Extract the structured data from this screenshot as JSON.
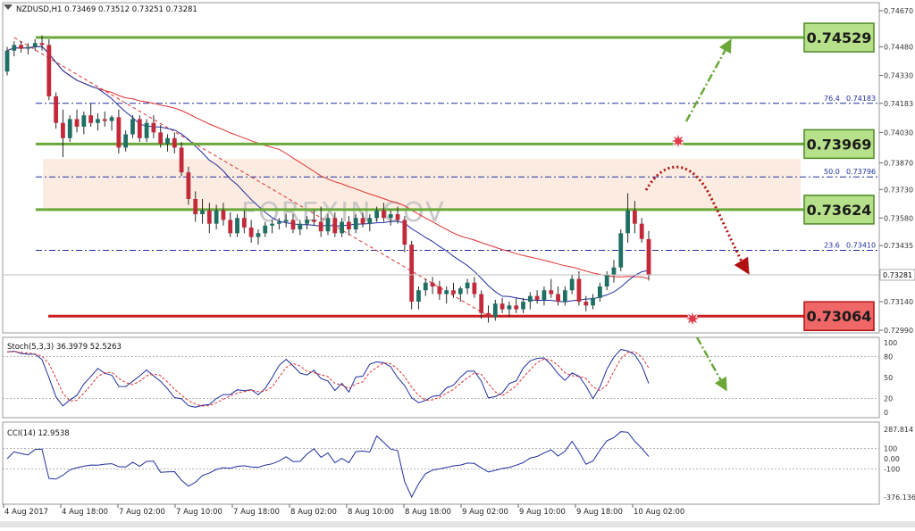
{
  "chart_data": [
    {
      "type": "candlestick",
      "symbol_header": "NZDUSD,H1  0.73469 0.73512 0.73251 0.73281",
      "watermark": "FOREXIN.COV",
      "ylim": [
        0.7299,
        0.7467
      ],
      "y_ticks": [
        "0.74670",
        "0.74480",
        "0.74330",
        "0.74183",
        "0.74030",
        "0.73870",
        "0.73730",
        "0.73580",
        "0.73435",
        "0.73140",
        "0.72990"
      ],
      "current_price": "0.73281",
      "x_ticks": [
        "4 Aug 2017",
        "4 Aug 18:00",
        "7 Aug 02:00",
        "7 Aug 10:00",
        "7 Aug 18:00",
        "8 Aug 02:00",
        "8 Aug 10:00",
        "8 Aug 18:00",
        "9 Aug 02:00",
        "9 Aug 10:00",
        "9 Aug 18:00",
        "10 Aug 02:00"
      ],
      "levels": [
        {
          "label": "0.74529",
          "value": 0.74529,
          "color": "#6aa83a"
        },
        {
          "label": "0.73969",
          "value": 0.73969,
          "color": "#6aa83a"
        },
        {
          "label": "0.73624",
          "value": 0.73624,
          "color": "#6aa83a"
        },
        {
          "label": "0.73064",
          "value": 0.73064,
          "color": "#cc1f1f"
        }
      ],
      "fibonacci": [
        {
          "label": "76.4",
          "price": "0.74183",
          "value": 0.74183
        },
        {
          "label": "50.0",
          "price": "0.73796",
          "value": 0.73796
        },
        {
          "label": "23.6",
          "price": "0.73410",
          "value": 0.7341
        }
      ],
      "zone": [
        0.73624,
        0.7389
      ],
      "candles": [
        [
          0.7435,
          0.7448,
          0.7433,
          0.7446
        ],
        [
          0.7446,
          0.7451,
          0.7443,
          0.7449
        ],
        [
          0.7449,
          0.7451,
          0.7445,
          0.7447
        ],
        [
          0.7447,
          0.745,
          0.7444,
          0.7448
        ],
        [
          0.7448,
          0.7452,
          0.7446,
          0.745
        ],
        [
          0.745,
          0.7454,
          0.7446,
          0.7449
        ],
        [
          0.7449,
          0.7452,
          0.742,
          0.7422
        ],
        [
          0.7422,
          0.7424,
          0.7405,
          0.7408
        ],
        [
          0.7408,
          0.7415,
          0.739,
          0.74
        ],
        [
          0.74,
          0.7412,
          0.7398,
          0.741
        ],
        [
          0.741,
          0.7415,
          0.7403,
          0.7406
        ],
        [
          0.7406,
          0.7414,
          0.7402,
          0.7412
        ],
        [
          0.7412,
          0.7418,
          0.7406,
          0.7408
        ],
        [
          0.7408,
          0.7413,
          0.7404,
          0.741
        ],
        [
          0.741,
          0.7414,
          0.7406,
          0.7409
        ],
        [
          0.7409,
          0.7412,
          0.7404,
          0.7411
        ],
        [
          0.7411,
          0.7415,
          0.7392,
          0.7395
        ],
        [
          0.7395,
          0.7404,
          0.7393,
          0.7402
        ],
        [
          0.7402,
          0.7412,
          0.74,
          0.741
        ],
        [
          0.741,
          0.7412,
          0.7398,
          0.74
        ],
        [
          0.74,
          0.741,
          0.7398,
          0.7408
        ],
        [
          0.7408,
          0.7412,
          0.74,
          0.7403
        ],
        [
          0.7403,
          0.7407,
          0.7395,
          0.7397
        ],
        [
          0.7397,
          0.7402,
          0.7393,
          0.74
        ],
        [
          0.74,
          0.7403,
          0.7392,
          0.7395
        ],
        [
          0.7395,
          0.7398,
          0.738,
          0.7382
        ],
        [
          0.7382,
          0.7385,
          0.7365,
          0.7368
        ],
        [
          0.7368,
          0.7372,
          0.7356,
          0.736
        ],
        [
          0.736,
          0.7368,
          0.7355,
          0.7362
        ],
        [
          0.7362,
          0.7366,
          0.735,
          0.7355
        ],
        [
          0.7355,
          0.7365,
          0.7352,
          0.7362
        ],
        [
          0.7362,
          0.7366,
          0.7354,
          0.7357
        ],
        [
          0.7357,
          0.7361,
          0.7348,
          0.735
        ],
        [
          0.735,
          0.736,
          0.7348,
          0.7358
        ],
        [
          0.7358,
          0.7362,
          0.735,
          0.7353
        ],
        [
          0.7353,
          0.7357,
          0.7345,
          0.7348
        ],
        [
          0.7348,
          0.7352,
          0.7344,
          0.735
        ],
        [
          0.735,
          0.7356,
          0.7348,
          0.7354
        ],
        [
          0.7354,
          0.7357,
          0.735,
          0.7355
        ],
        [
          0.7355,
          0.7358,
          0.7352,
          0.7356
        ],
        [
          0.7356,
          0.736,
          0.7353,
          0.7357
        ],
        [
          0.7357,
          0.736,
          0.735,
          0.7352
        ],
        [
          0.7352,
          0.7357,
          0.7349,
          0.7355
        ],
        [
          0.7355,
          0.7359,
          0.7352,
          0.7357
        ],
        [
          0.7357,
          0.7362,
          0.7354,
          0.7356
        ],
        [
          0.7356,
          0.7364,
          0.7348,
          0.7351
        ],
        [
          0.7351,
          0.736,
          0.7349,
          0.7358
        ],
        [
          0.7358,
          0.7361,
          0.7348,
          0.735
        ],
        [
          0.735,
          0.7358,
          0.7348,
          0.7356
        ],
        [
          0.7356,
          0.7359,
          0.7349,
          0.7352
        ],
        [
          0.7352,
          0.736,
          0.735,
          0.7358
        ],
        [
          0.7358,
          0.7361,
          0.7353,
          0.7355
        ],
        [
          0.7355,
          0.736,
          0.7351,
          0.7358
        ],
        [
          0.7358,
          0.7364,
          0.7356,
          0.7362
        ],
        [
          0.7362,
          0.7366,
          0.7356,
          0.7358
        ],
        [
          0.7358,
          0.7362,
          0.7354,
          0.736
        ],
        [
          0.736,
          0.7364,
          0.7355,
          0.7357
        ],
        [
          0.7357,
          0.7359,
          0.734,
          0.7344
        ],
        [
          0.7344,
          0.7346,
          0.731,
          0.7314
        ],
        [
          0.7314,
          0.7322,
          0.731,
          0.732
        ],
        [
          0.732,
          0.7326,
          0.7317,
          0.7324
        ],
        [
          0.7324,
          0.7327,
          0.7318,
          0.7322
        ],
        [
          0.7322,
          0.7325,
          0.7315,
          0.7318
        ],
        [
          0.7318,
          0.7322,
          0.7313,
          0.732
        ],
        [
          0.732,
          0.7324,
          0.7316,
          0.7318
        ],
        [
          0.7318,
          0.7322,
          0.7314,
          0.7321
        ],
        [
          0.7321,
          0.7326,
          0.7318,
          0.7324
        ],
        [
          0.7324,
          0.7327,
          0.7316,
          0.7318
        ],
        [
          0.7318,
          0.732,
          0.7305,
          0.7308
        ],
        [
          0.7308,
          0.7312,
          0.7303,
          0.7306
        ],
        [
          0.7306,
          0.7315,
          0.7304,
          0.7313
        ],
        [
          0.7313,
          0.7316,
          0.7308,
          0.731
        ],
        [
          0.731,
          0.7314,
          0.7306,
          0.7312
        ],
        [
          0.7312,
          0.7316,
          0.7308,
          0.731
        ],
        [
          0.731,
          0.7316,
          0.7308,
          0.7314
        ],
        [
          0.7314,
          0.7319,
          0.731,
          0.7317
        ],
        [
          0.7317,
          0.732,
          0.7313,
          0.7315
        ],
        [
          0.7315,
          0.7322,
          0.7312,
          0.732
        ],
        [
          0.732,
          0.7326,
          0.7316,
          0.7318
        ],
        [
          0.7318,
          0.7322,
          0.7312,
          0.7314
        ],
        [
          0.7314,
          0.7322,
          0.7312,
          0.732
        ],
        [
          0.732,
          0.7328,
          0.7318,
          0.7326
        ],
        [
          0.7326,
          0.733,
          0.7312,
          0.7314
        ],
        [
          0.7314,
          0.7317,
          0.7309,
          0.7312
        ],
        [
          0.7312,
          0.7318,
          0.731,
          0.7316
        ],
        [
          0.7316,
          0.7324,
          0.7314,
          0.7322
        ],
        [
          0.7322,
          0.733,
          0.732,
          0.7328
        ],
        [
          0.7328,
          0.7336,
          0.7324,
          0.7332
        ],
        [
          0.7332,
          0.7352,
          0.733,
          0.735
        ],
        [
          0.735,
          0.7371,
          0.7345,
          0.7362
        ],
        [
          0.7362,
          0.7367,
          0.735,
          0.7355
        ],
        [
          0.7355,
          0.7358,
          0.7345,
          0.7347
        ],
        [
          0.73469,
          0.73512,
          0.73251,
          0.73281
        ]
      ],
      "stochastic": {
        "label": "Stoch(5,3,3) 36.3979 52.5263",
        "y_ticks": [
          "100",
          "80",
          "50",
          "20",
          "0"
        ]
      },
      "cci": {
        "label": "CCI(14) 12.9538",
        "y_ticks": [
          "287.814",
          "100",
          "0.00",
          "-100",
          "-376.1368"
        ]
      }
    }
  ]
}
